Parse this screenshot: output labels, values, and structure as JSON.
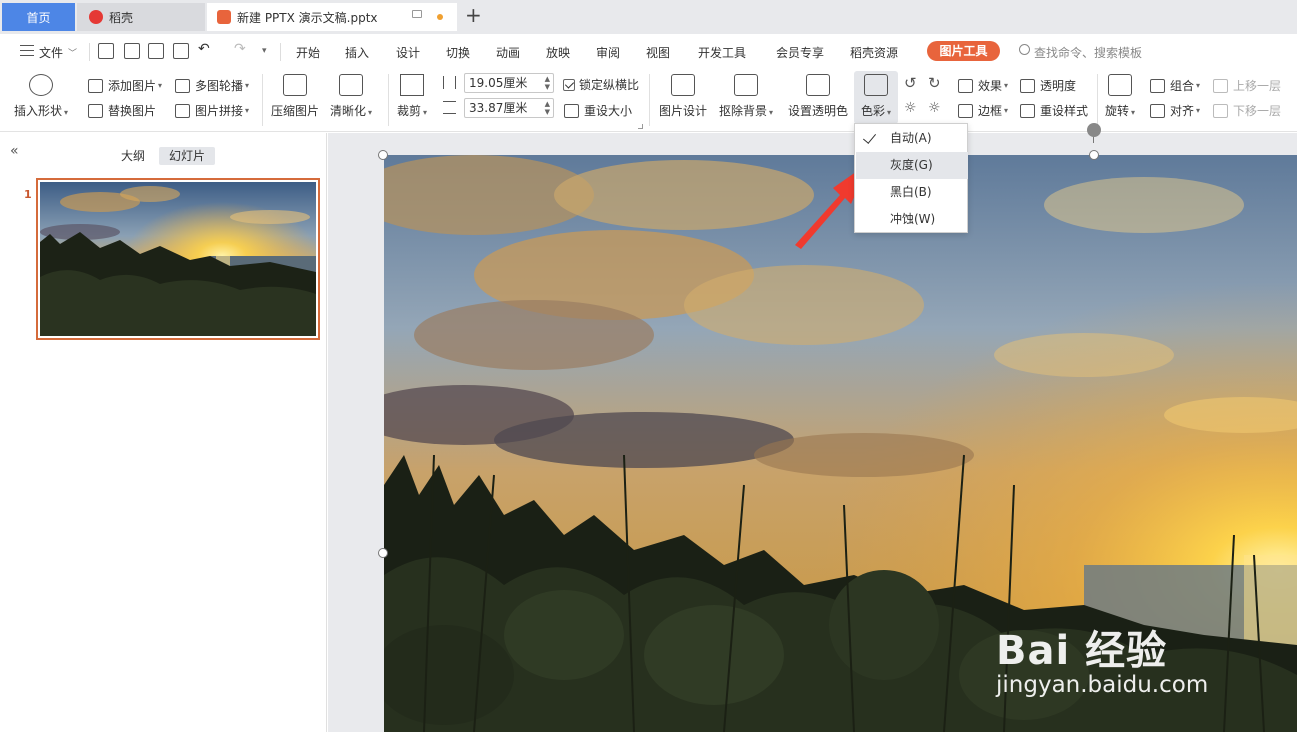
{
  "tabs": {
    "home": "首页",
    "daoke": "稻壳",
    "document": "新建 PPTX 演示文稿.pptx"
  },
  "menu": {
    "file": "文件",
    "items": [
      "开始",
      "插入",
      "设计",
      "切换",
      "动画",
      "放映",
      "审阅",
      "视图",
      "开发工具",
      "会员专享",
      "稻壳资源"
    ],
    "picture_tools": "图片工具",
    "search_placeholder": "查找命令、搜索模板"
  },
  "ribbon": {
    "insert_shape": "插入形状",
    "add_picture": "添加图片",
    "replace_picture": "替换图片",
    "multi_carousel": "多图轮播",
    "picture_splice": "图片拼接",
    "compress": "压缩图片",
    "sharpen": "清晰化",
    "crop": "裁剪",
    "height_value": "19.05厘米",
    "width_value": "33.87厘米",
    "lock_ratio": "锁定纵横比",
    "reset_size": "重设大小",
    "picture_design": "图片设计",
    "remove_background": "抠除背景",
    "set_transparent_color": "设置透明色",
    "color": "色彩",
    "effects": "效果",
    "transparency": "透明度",
    "border": "边框",
    "reset_style": "重设样式",
    "rotate": "旋转",
    "group": "组合",
    "align": "对齐",
    "bring_forward": "上移一层",
    "send_backward": "下移一层"
  },
  "left_panel": {
    "outline_tab": "大纲",
    "slides_tab": "幻灯片",
    "slide_number": "1"
  },
  "color_dropdown": {
    "items": [
      {
        "label": "自动(A)",
        "checked": true
      },
      {
        "label": "灰度(G)",
        "hover": true
      },
      {
        "label": "黑白(B)"
      },
      {
        "label": "冲蚀(W)"
      }
    ]
  },
  "watermark": {
    "brand": "Bai 经验",
    "url": "jingyan.baidu.com"
  },
  "colors": {
    "accent": "#e8643c",
    "home_tab": "#4d86e6",
    "arrow": "#f03a2e"
  }
}
